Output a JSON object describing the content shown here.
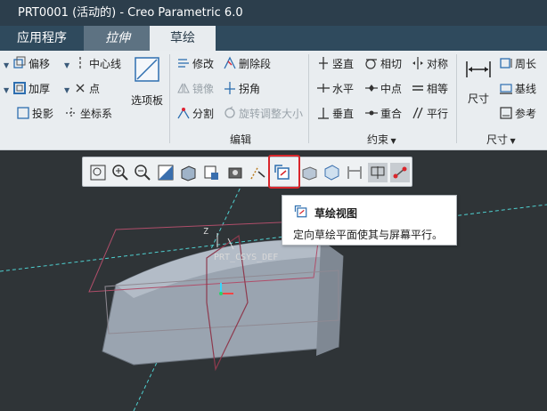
{
  "titlebar": {
    "title": "PRT0001 (活动的) - Creo Parametric 6.0"
  },
  "tabs": [
    {
      "label": "应用程序"
    },
    {
      "label": "拉伸"
    },
    {
      "label": "草绘"
    }
  ],
  "ribbon": {
    "setup_items": [
      {
        "label": "偏移",
        "icon": "offset-icon"
      },
      {
        "label": "加厚",
        "icon": "thicken-icon"
      },
      {
        "label": "投影",
        "icon": "project-icon"
      },
      {
        "label": "中心线",
        "icon": "centerline-icon"
      },
      {
        "label": "点",
        "icon": "point-icon"
      },
      {
        "label": "坐标系",
        "icon": "coordinate-system-icon"
      }
    ],
    "palette_label": "选项板",
    "edit_items": [
      {
        "label": "修改",
        "icon": "modify-icon"
      },
      {
        "label": "删除段",
        "icon": "delete-segment-icon"
      },
      {
        "label": "镜像",
        "icon": "mirror-icon"
      },
      {
        "label": "拐角",
        "icon": "corner-icon"
      },
      {
        "label": "分割",
        "icon": "divide-icon"
      },
      {
        "label": "旋转调整大小",
        "icon": "rotate-resize-icon"
      }
    ],
    "edit_group_label": "编辑",
    "constrain_items": [
      {
        "label": "竖直",
        "icon": "vertical-icon"
      },
      {
        "label": "相切",
        "icon": "tangent-icon"
      },
      {
        "label": "对称",
        "icon": "symmetric-icon"
      },
      {
        "label": "水平",
        "icon": "horizontal-icon"
      },
      {
        "label": "中点",
        "icon": "midpoint-icon"
      },
      {
        "label": "相等",
        "icon": "equal-icon"
      },
      {
        "label": "垂直",
        "icon": "perpendicular-icon"
      },
      {
        "label": "重合",
        "icon": "coincident-icon"
      },
      {
        "label": "平行",
        "icon": "parallel-icon"
      }
    ],
    "constrain_group_label": "约束",
    "dimension_big_label": "尺寸",
    "dimension_items": [
      {
        "label": "周长",
        "icon": "perimeter-icon"
      },
      {
        "label": "基线",
        "icon": "baseline-icon"
      },
      {
        "label": "参考",
        "icon": "reference-icon"
      }
    ],
    "dimension_group_label": "尺寸"
  },
  "graphics_toolbar": {
    "buttons": [
      "refit-icon",
      "zoom-in-icon",
      "zoom-out-icon",
      "repaint-icon",
      "display-style-icon",
      "saved-orientations-icon",
      "view-manager-icon",
      "datum-display-filter-icon",
      "sketch-view-icon",
      "shading-icon",
      "perspective-icon",
      "dimension-display-icon",
      "constraint-display-icon",
      "vertex-display-icon"
    ],
    "highlighted": "sketch-view-icon"
  },
  "tooltip": {
    "title": "草绘视图",
    "description": "定向草绘平面使其与屏幕平行。"
  },
  "viewport": {
    "csys_label": "PRT_CSYS_DEF",
    "axis_label": "Z"
  },
  "colors": {
    "title_bar": "#2c3e4c",
    "tab_active": "#e8ecef",
    "ribbon": "#e9edf0",
    "viewport": "#2f3437",
    "highlight": "#d9262c",
    "datum_plane": "#c0506a",
    "axis": "#4fd0d0"
  }
}
